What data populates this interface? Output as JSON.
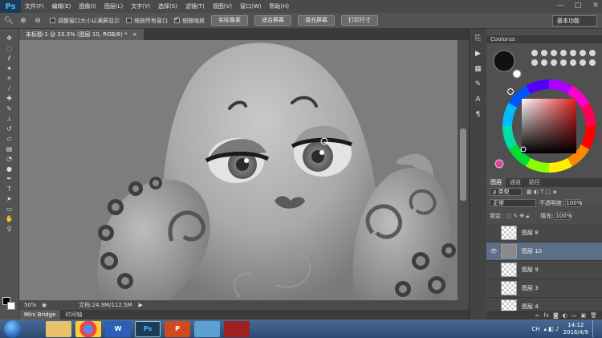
{
  "app": {
    "logo": "Ps"
  },
  "menubar": {
    "items": [
      "文件(F)",
      "编辑(E)",
      "图像(I)",
      "图层(L)",
      "文字(Y)",
      "选择(S)",
      "滤镜(T)",
      "视图(V)",
      "窗口(W)",
      "帮助(H)"
    ],
    "win_controls": [
      "—",
      "□",
      "✕"
    ]
  },
  "options": {
    "zoom_tool_icon": "zoom-icon",
    "check_resize": "调整窗口大小以满屏显示",
    "check_zoom_all": "缩放所有窗口",
    "check_scrubby": "细微缩放",
    "btn_actual": "实际像素",
    "btn_fit": "适合屏幕",
    "btn_fill": "填充屏幕",
    "btn_print": "打印尺寸",
    "workspace": "基本功能"
  },
  "document": {
    "tab_title": "未标题-1 @ 33.3% (图层 10, RGB/8) *",
    "zoom": "50%",
    "doc_info": "文档:24.9M/112.5M"
  },
  "mini_bridge": {
    "tab1": "Mini Bridge",
    "tab2": "时间轴"
  },
  "coolorus": {
    "title": "Coolorus"
  },
  "layers": {
    "tabs": [
      "图层",
      "通道",
      "路径"
    ],
    "filter": "ρ 类型",
    "blend": "正常",
    "opacity_label": "不透明度:",
    "opacity_value": "100%",
    "lock_label": "锁定:",
    "fill_label": "填充:",
    "fill_value": "100%",
    "items": [
      {
        "name": "图层 8"
      },
      {
        "name": "图层 10"
      },
      {
        "name": "图层 9"
      },
      {
        "name": "图层 3"
      },
      {
        "name": "图层 4"
      }
    ]
  },
  "taskbar": {
    "apps": [
      "W",
      "Ps",
      "P"
    ],
    "tray_lang": "CH",
    "time": "14:12",
    "date": "2016/4/9"
  },
  "colors": {
    "accent": "#4fb3ff",
    "selection": "#5d6f86"
  }
}
